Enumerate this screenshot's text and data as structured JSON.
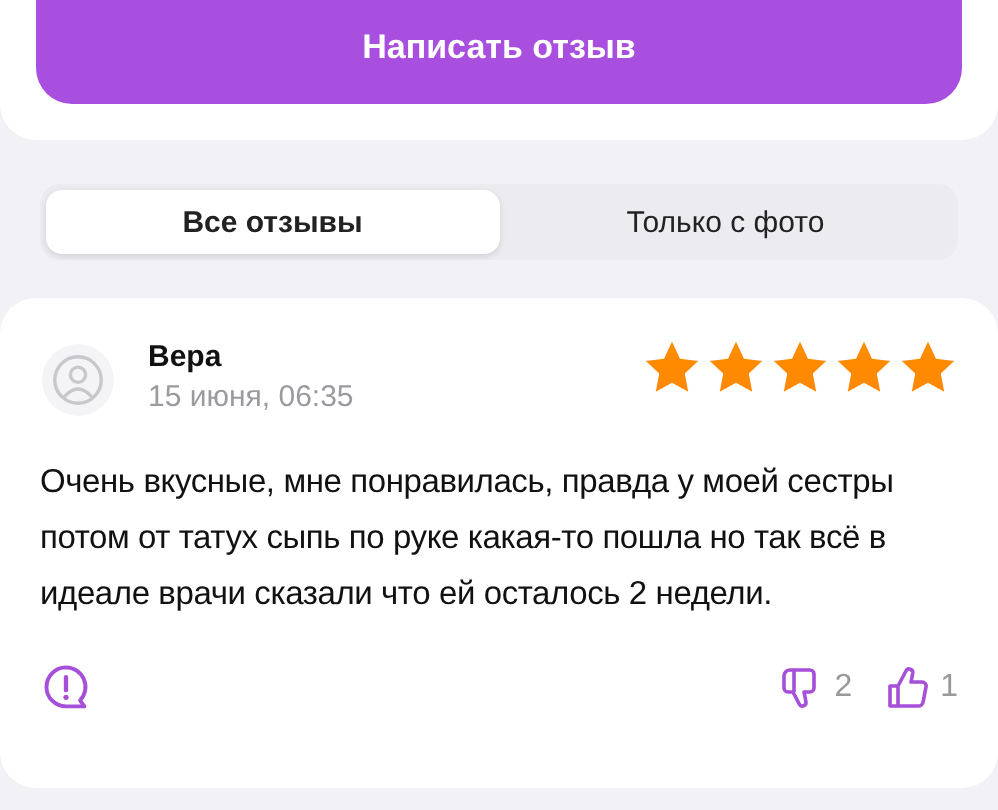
{
  "write_button": {
    "label": "Написать отзыв"
  },
  "filter_tabs": [
    {
      "label": "Все отзывы",
      "selected": true
    },
    {
      "label": "Только с фото",
      "selected": false
    }
  ],
  "review": {
    "author": "Вера",
    "date": "15 июня, 06:35",
    "stars": 5,
    "text": "Очень вкусные, мне понравилась, правда у моей сестры потом от татух сыпь по руке какая-то пошла но так всё в идеале врачи сказали что ей осталось 2 недели.",
    "dislikes": "2",
    "likes": "1"
  }
}
